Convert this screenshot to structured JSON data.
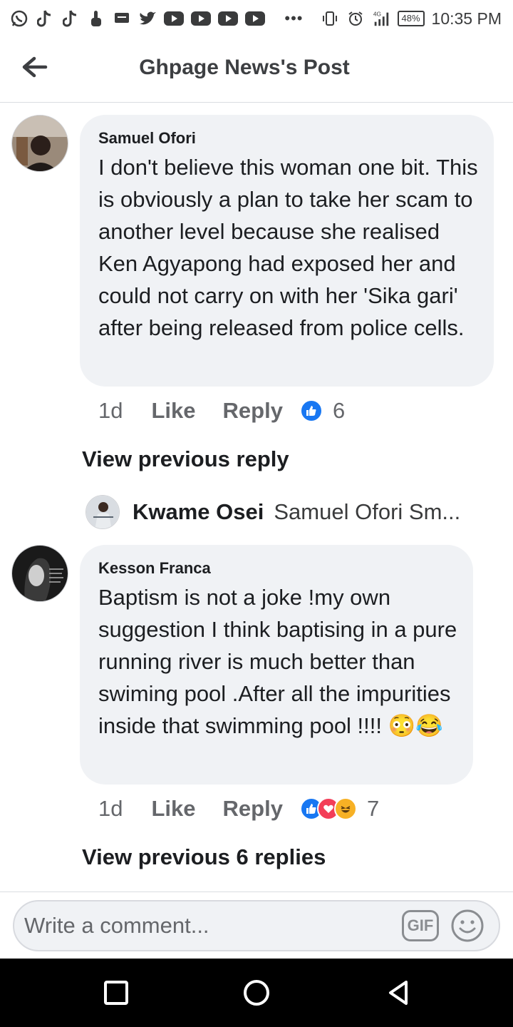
{
  "status_bar": {
    "time": "10:35 PM",
    "battery": "48%",
    "network": "4G",
    "overflow": "•••",
    "app_icons": [
      "whatsapp-icon",
      "tiktok-icon",
      "tiktok-icon",
      "touch-icon",
      "message-icon",
      "twitter-icon",
      "youtube-icon",
      "youtube-icon",
      "youtube-icon",
      "youtube-icon"
    ]
  },
  "header": {
    "title": "Ghpage News's Post"
  },
  "comments": [
    {
      "author": "Samuel Ofori",
      "text": "I don't believe this woman one bit. This is obviously a plan to take her scam to another level because she realised Ken Agyapong had exposed her and could not carry on with her 'Sika gari' after being released from police cells.",
      "time": "1d",
      "like_label": "Like",
      "reply_label": "Reply",
      "reaction_count": "6",
      "reactions": [
        "like"
      ],
      "view_previous": "View previous reply",
      "reply_preview": {
        "author": "Kwame Osei",
        "text": "Samuel Ofori Sm..."
      }
    },
    {
      "author": "Kesson Franca",
      "text": "Baptism is not a joke !my own suggestion I think baptising in a pure running  river is much better than swiming pool .After all the impurities inside that swimming pool !!!! 😳😂",
      "time": "1d",
      "like_label": "Like",
      "reply_label": "Reply",
      "reaction_count": "7",
      "reactions": [
        "like",
        "love",
        "haha"
      ],
      "view_previous": "View previous 6 replies"
    }
  ],
  "composer": {
    "placeholder": "Write a comment...",
    "gif_label": "GIF"
  },
  "colors": {
    "bubble": "#f0f2f5",
    "like_blue": "#1877f2",
    "love_red": "#f33e58",
    "haha_yellow": "#f7b125",
    "secondary_text": "#65676b"
  }
}
